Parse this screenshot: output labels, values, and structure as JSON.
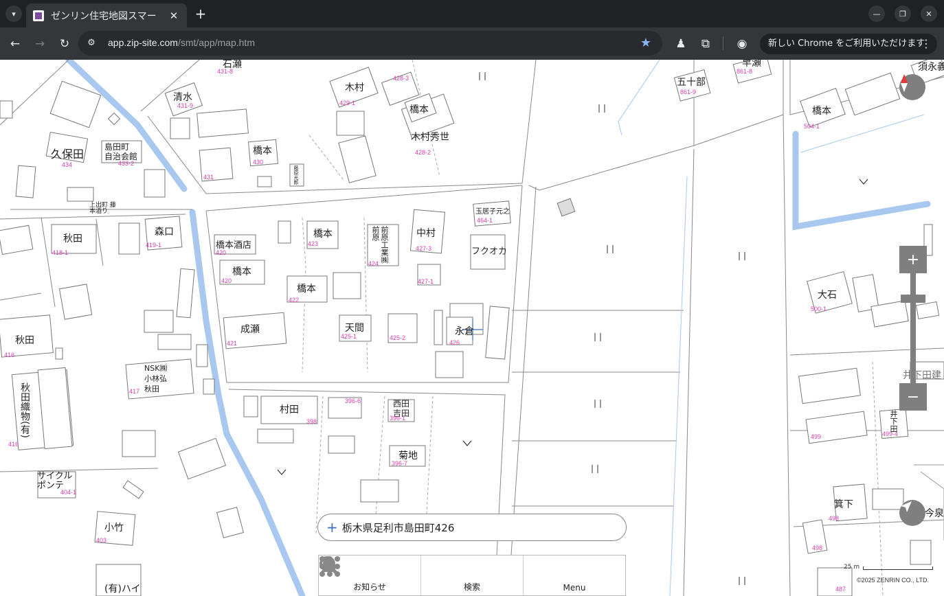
{
  "browser": {
    "tab_title": "ゼンリン住宅地図スマー",
    "url_host": "app.zip-site.com",
    "url_path": "/smt/app/map.htm",
    "update_label": "新しい Chrome をご利用いただけます"
  },
  "map": {
    "buildings": [
      {
        "name": "石瀬",
        "num": "431-8"
      },
      {
        "name": "清水",
        "num": "431-9"
      },
      {
        "name": "木村",
        "num": "429-1"
      },
      {
        "name": "橋本",
        "num": "428-3"
      },
      {
        "name": "木村秀世",
        "num": "428-2"
      },
      {
        "name": "五十部",
        "num": "861-9"
      },
      {
        "name": "早瀬",
        "num": "861-8"
      },
      {
        "name": "須永義",
        "num": ""
      },
      {
        "name": "久保田",
        "num": "434"
      },
      {
        "name": "島田町\n自治会館",
        "num": "433-2"
      },
      {
        "name": "橋本",
        "num": "430"
      },
      {
        "name": "橋本",
        "num": "504-1"
      },
      {
        "name": "秋田",
        "num": "418-1"
      },
      {
        "name": "森口",
        "num": "419-1"
      },
      {
        "name": "橋本酒店",
        "num": "420"
      },
      {
        "name": "橋本",
        "num": "423"
      },
      {
        "name": "前原",
        "num": ""
      },
      {
        "name": "前原工業㈱",
        "num": "424"
      },
      {
        "name": "中村",
        "num": "427-3"
      },
      {
        "name": "玉居子元之",
        "num": "464-1"
      },
      {
        "name": "フクオカ",
        "num": ""
      },
      {
        "name": "橋本",
        "num": "420"
      },
      {
        "name": "橋本",
        "num": "422"
      },
      {
        "name": "大石",
        "num": "500-1"
      },
      {
        "name": "成瀬",
        "num": "421"
      },
      {
        "name": "天間",
        "num": "425-1"
      },
      {
        "name": "永倉",
        "num": "426"
      },
      {
        "name": "秋田",
        "num": "416"
      },
      {
        "name": "NSK㈱\n小林弘\n秋田",
        "num": "417"
      },
      {
        "name": "井下田建",
        "num": ""
      },
      {
        "name": "秋田織物(有)",
        "num": "416"
      },
      {
        "name": "村田",
        "num": "398"
      },
      {
        "name": "西田\n吉田",
        "num": "396-1"
      },
      {
        "name": "井下田",
        "num": "499-4"
      },
      {
        "name": "菊地",
        "num": "396-7"
      },
      {
        "name": "サイクルポンテ",
        "num": "404-1"
      },
      {
        "name": "小竹",
        "num": "403"
      },
      {
        "name": "箕下",
        "num": "498"
      },
      {
        "name": "今泉",
        "num": ""
      },
      {
        "name": "(有)ハイ",
        "num": ""
      }
    ],
    "extra_nums": [
      "431",
      "427-1",
      "425-2",
      "396-6",
      "499",
      "498",
      "487"
    ],
    "small_text": {
      "street": "上出町 藤本酒り",
      "vertical": "藤原光郎"
    },
    "search_address": "栃木県足利市島田町426",
    "nav": [
      {
        "label": "お知らせ",
        "icon": "bell-icon"
      },
      {
        "label": "検索",
        "icon": "search-icon"
      },
      {
        "label": "Menu",
        "icon": "grid-icon"
      }
    ],
    "scale_label": "25 m",
    "copyright": "©2025 ZENRIN CO., LTD.",
    "colors": {
      "water": "#a8c8f0",
      "number": "#d63fb0",
      "control": "#7f7f7f"
    }
  }
}
